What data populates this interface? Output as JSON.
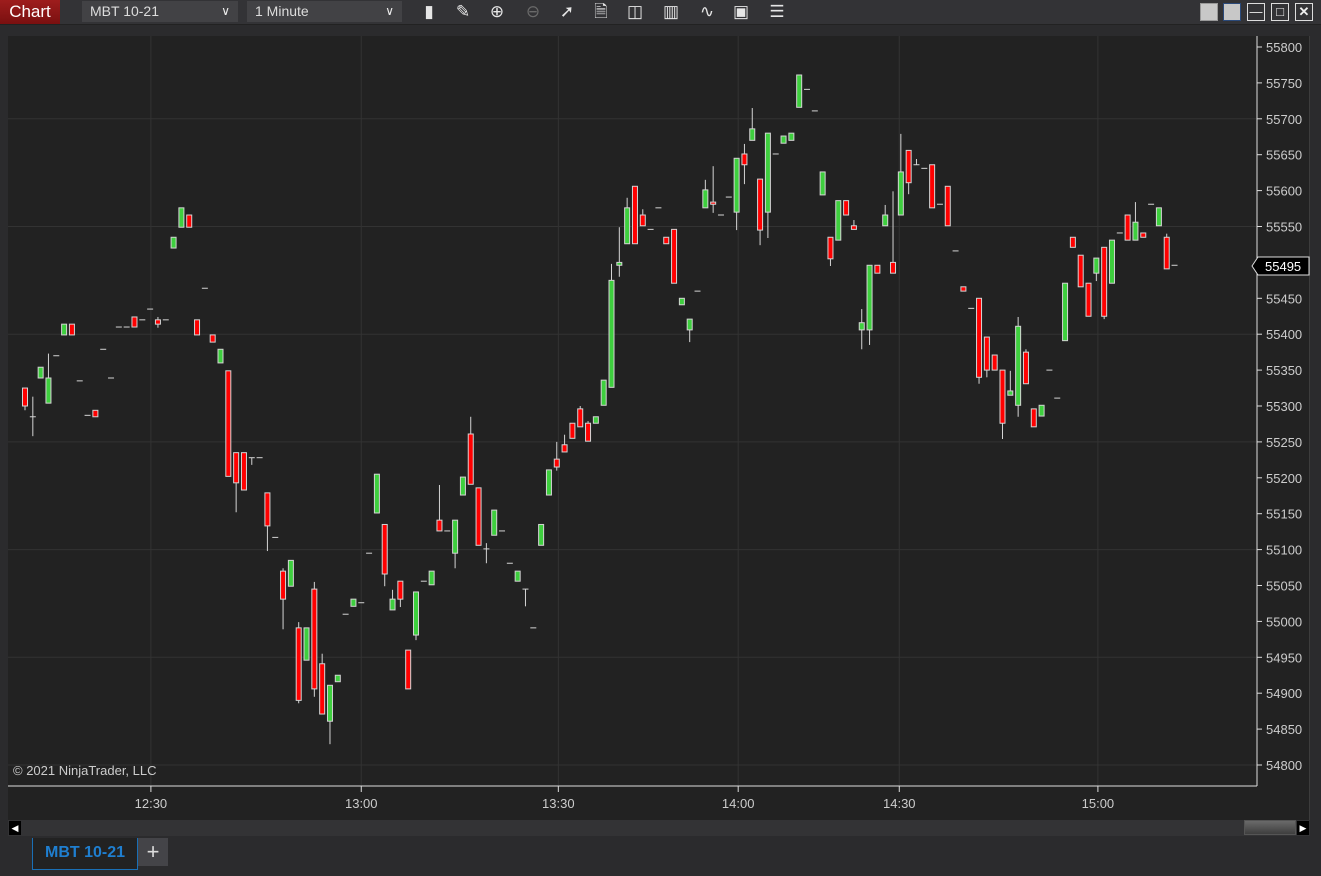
{
  "toolbar": {
    "tag": "Chart",
    "instrument": "MBT 10-21",
    "interval": "1 Minute",
    "tools": [
      {
        "name": "bars-type-icon",
        "glyph": "▮"
      },
      {
        "name": "drawing-tool-icon",
        "glyph": "✎"
      },
      {
        "name": "zoom-in-icon",
        "glyph": "⊕"
      },
      {
        "name": "zoom-out-icon",
        "glyph": "⊖"
      },
      {
        "name": "pointer-icon",
        "glyph": "➚"
      },
      {
        "name": "data-box-icon",
        "glyph": "🗎"
      },
      {
        "name": "chart-trader-icon",
        "glyph": "◫"
      },
      {
        "name": "indicators-icon",
        "glyph": "▥"
      },
      {
        "name": "strategies-icon",
        "glyph": "∿"
      },
      {
        "name": "templates-icon",
        "glyph": "▣"
      },
      {
        "name": "properties-icon",
        "glyph": "☰"
      }
    ]
  },
  "colors": {
    "up": "#3ecf3e",
    "down": "#ff0000",
    "outline": "#d4d4d4",
    "grid": "#333333",
    "bg": "#222222"
  },
  "copyright": "© 2021 NinjaTrader, LLC",
  "tabs": [
    {
      "label": "MBT 10-21"
    }
  ],
  "add_tab_label": "+",
  "chart_data": {
    "type": "candlestick",
    "instrument": "MBT 10-21",
    "interval": "1 Minute",
    "ylim": [
      54800,
      55800
    ],
    "y_ticks": [
      55800,
      55750,
      55700,
      55650,
      55600,
      55550,
      55500,
      55450,
      55400,
      55350,
      55300,
      55250,
      55200,
      55150,
      55100,
      55050,
      55000,
      54950,
      54900,
      54850,
      54800
    ],
    "gridlines_y": [
      55700,
      55550,
      55400,
      55250,
      55100,
      54950,
      54800
    ],
    "x_ticks": [
      {
        "label": "12:30",
        "bar": 16.1
      },
      {
        "label": "13:00",
        "bar": 43
      },
      {
        "label": "13:30",
        "bar": 68.2
      },
      {
        "label": "14:00",
        "bar": 91.2
      },
      {
        "label": "14:30",
        "bar": 111.8
      },
      {
        "label": "15:00",
        "bar": 137.2
      }
    ],
    "last_price": "55495",
    "ohlc_fields": [
      "open",
      "high",
      "low",
      "close"
    ],
    "candles": [
      [
        55325,
        55325,
        55294,
        55300
      ],
      [
        55285,
        55313,
        55258,
        55285
      ],
      [
        55339,
        55354,
        55339,
        55354
      ],
      [
        55304,
        55373,
        55304,
        55339
      ],
      [
        55370
      ],
      [
        55399,
        55414,
        55399,
        55414
      ],
      [
        55414,
        55414,
        55399,
        55399
      ],
      [
        55335
      ],
      [
        55287
      ],
      [
        55294,
        55294,
        55285,
        55285
      ],
      [
        55379
      ],
      [
        55339
      ],
      [
        55410
      ],
      [
        55410
      ],
      [
        55424,
        55424,
        55410,
        55410
      ],
      [
        55420
      ],
      [
        55435
      ],
      [
        55420,
        55424,
        55409,
        55414
      ],
      [
        55420
      ],
      [
        55520,
        55535,
        55520,
        55535
      ],
      [
        55549,
        55576,
        55549,
        55576
      ],
      [
        55566,
        55566,
        55549,
        55549
      ],
      [
        55420,
        55420,
        55399,
        55399
      ],
      [
        55464
      ],
      [
        55399,
        55399,
        55389,
        55389
      ],
      [
        55360,
        55379,
        55360,
        55379
      ],
      [
        55349,
        55349,
        55202,
        55202
      ],
      [
        55235,
        55235,
        55152,
        55193
      ],
      [
        55235,
        55235,
        55183,
        55183
      ],
      [
        55228,
        55228,
        55218,
        55228
      ],
      [
        55228
      ],
      [
        55179,
        55179,
        55098,
        55133
      ],
      [
        55117
      ],
      [
        55070,
        55074,
        54989,
        55031
      ],
      [
        55049,
        55085,
        55049,
        55085
      ],
      [
        54991,
        54999,
        54886,
        54890
      ],
      [
        54946,
        54991,
        54946,
        54991
      ],
      [
        55045,
        55055,
        54895,
        54906
      ],
      [
        54941,
        54955,
        54871,
        54871
      ],
      [
        54861,
        54911,
        54829,
        54911
      ],
      [
        54916,
        54925,
        54916,
        54925
      ],
      [
        55010
      ],
      [
        55021,
        55031,
        55021,
        55031
      ],
      [
        55026
      ],
      [
        55095
      ],
      [
        55151,
        55205,
        55151,
        55205
      ],
      [
        55135,
        55135,
        55049,
        55066
      ],
      [
        55016,
        55044,
        55016,
        55031
      ],
      [
        55056,
        55056,
        55020,
        55031
      ],
      [
        54960,
        54960,
        54906,
        54906
      ],
      [
        54981,
        55041,
        54974,
        55041
      ],
      [
        55056
      ],
      [
        55051,
        55070,
        55051,
        55070
      ],
      [
        55141,
        55190,
        55126,
        55126
      ],
      [
        55126
      ],
      [
        55095,
        55141,
        55074,
        55141
      ],
      [
        55176,
        55201,
        55176,
        55201
      ],
      [
        55261,
        55285,
        55191,
        55191
      ],
      [
        55186,
        55186,
        55106,
        55106
      ],
      [
        55101,
        55109,
        55081,
        55101
      ],
      [
        55120,
        55155,
        55120,
        55155
      ],
      [
        55126
      ],
      [
        55081
      ],
      [
        55056,
        55070,
        55056,
        55070
      ],
      [
        55045,
        55045,
        55021,
        55045
      ],
      [
        54991
      ],
      [
        55106,
        55135,
        55106,
        55135
      ],
      [
        55176,
        55211,
        55176,
        55211
      ],
      [
        55226,
        55250,
        55210,
        55215
      ],
      [
        55246,
        55260,
        55236,
        55236
      ],
      [
        55276,
        55276,
        55255,
        55255
      ],
      [
        55296,
        55300,
        55271,
        55271
      ],
      [
        55276,
        55279,
        55251,
        55251
      ],
      [
        55276,
        55285,
        55276,
        55285
      ],
      [
        55301,
        55336,
        55301,
        55336
      ],
      [
        55326,
        55498,
        55326,
        55475
      ],
      [
        55496,
        55549,
        55480,
        55500
      ],
      [
        55526,
        55590,
        55526,
        55576
      ],
      [
        55606,
        55606,
        55526,
        55526
      ],
      [
        55566,
        55574,
        55551,
        55551
      ],
      [
        55546
      ],
      [
        55576
      ],
      [
        55535,
        55535,
        55526,
        55526
      ],
      [
        55546,
        55546,
        55471,
        55471
      ],
      [
        55441,
        55450,
        55441,
        55450
      ],
      [
        55406,
        55421,
        55389,
        55421
      ],
      [
        55460
      ],
      [
        55576,
        55615,
        55576,
        55601
      ],
      [
        55584,
        55634,
        55569,
        55581
      ],
      [
        55566
      ],
      [
        55591
      ],
      [
        55570,
        55645,
        55545,
        55645
      ],
      [
        55651,
        55665,
        55609,
        55636
      ],
      [
        55670,
        55715,
        55670,
        55686
      ],
      [
        55616,
        55616,
        55524,
        55545
      ],
      [
        55570,
        55680,
        55534,
        55680
      ],
      [
        55651
      ],
      [
        55666,
        55676,
        55666,
        55676
      ],
      [
        55670,
        55680,
        55670,
        55680
      ],
      [
        55716,
        55761,
        55716,
        55761
      ],
      [
        55741
      ],
      [
        55711
      ],
      [
        55594,
        55626,
        55594,
        55626
      ],
      [
        55535,
        55535,
        55495,
        55505
      ],
      [
        55531,
        55586,
        55531,
        55586
      ],
      [
        55586,
        55586,
        55566,
        55566
      ],
      [
        55551,
        55559,
        55546,
        55546
      ],
      [
        55406,
        55435,
        55379,
        55416
      ],
      [
        55406,
        55496,
        55385,
        55496
      ],
      [
        55496,
        55496,
        55485,
        55485
      ],
      [
        55551,
        55580,
        55551,
        55566
      ],
      [
        55500,
        55599,
        55485,
        55485
      ],
      [
        55566,
        55679,
        55566,
        55626
      ],
      [
        55656,
        55656,
        55595,
        55611
      ],
      [
        55636,
        55644,
        55636,
        55636
      ],
      [
        55631
      ],
      [
        55636,
        55636,
        55576,
        55576
      ],
      [
        55581
      ],
      [
        55606,
        55606,
        55551,
        55551
      ],
      [
        55516
      ],
      [
        55466,
        55466,
        55460,
        55460
      ],
      [
        55436
      ],
      [
        55450,
        55450,
        55331,
        55340
      ],
      [
        55396,
        55396,
        55340,
        55350
      ],
      [
        55371,
        55371,
        55350,
        55350
      ],
      [
        55350,
        55350,
        55254,
        55276
      ],
      [
        55315,
        55349,
        55315,
        55321
      ],
      [
        55301,
        55424,
        55285,
        55411
      ],
      [
        55375,
        55379,
        55331,
        55331
      ],
      [
        55296,
        55296,
        55271,
        55271
      ],
      [
        55286,
        55301,
        55286,
        55301
      ],
      [
        55350
      ],
      [
        55311
      ],
      [
        55391,
        55471,
        55391,
        55471
      ],
      [
        55535,
        55535,
        55521,
        55521
      ],
      [
        55510,
        55510,
        55466,
        55466
      ],
      [
        55471,
        55471,
        55425,
        55425
      ],
      [
        55485,
        55506,
        55474,
        55506
      ],
      [
        55521,
        55521,
        55421,
        55425
      ],
      [
        55471,
        55531,
        55471,
        55531
      ],
      [
        55541
      ],
      [
        55566,
        55566,
        55531,
        55531
      ],
      [
        55531,
        55584,
        55531,
        55556
      ],
      [
        55541,
        55541,
        55535,
        55535
      ],
      [
        55581
      ],
      [
        55551,
        55576,
        55551,
        55576
      ],
      [
        55535,
        55540,
        55491,
        55491
      ],
      [
        55496
      ]
    ]
  }
}
